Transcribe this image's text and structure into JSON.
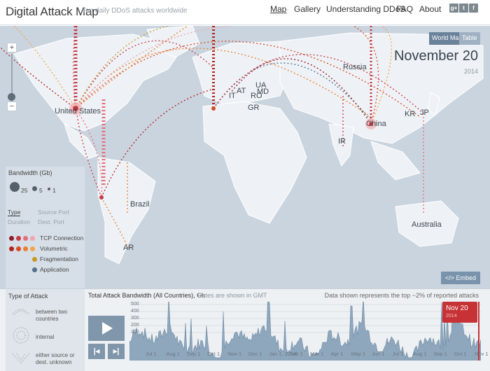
{
  "header": {
    "brand": "Digital Attack Map",
    "tagline": "Top daily DDoS attacks worldwide",
    "nav": [
      "Map",
      "Gallery",
      "Understanding DDoS",
      "FAQ",
      "About"
    ],
    "social": [
      "g+",
      "t",
      "f"
    ]
  },
  "map": {
    "view_world": "World Map",
    "view_table": "Table",
    "date": "November 20",
    "year": "2014",
    "zoom_in": "+",
    "zoom_out": "−",
    "embed": "</> Embed",
    "labels": {
      "us": "United States",
      "russia": "Russia",
      "brazil": "Brazil",
      "ar": "AR",
      "australia": "Australia",
      "china": "China",
      "kr": "KR",
      "jp": "JP",
      "gr": "GR",
      "ro": "RO",
      "md": "MD",
      "ua": "UA",
      "at": "AT",
      "it": "IT",
      "ir": "IR"
    }
  },
  "legend": {
    "title": "Bandwidth (Gb)",
    "sizes": [
      "25",
      "5",
      "1"
    ],
    "tabs": {
      "type": "Type",
      "source_port": "Source Port",
      "duration": "Duration",
      "dest_port": "Dest. Port"
    },
    "types": [
      {
        "label": "TCP Connection",
        "colors": [
          "#8e1d2c",
          "#c43b45",
          "#e36f79",
          "#f2a3b0"
        ]
      },
      {
        "label": "Volumetric",
        "colors": [
          "#b4231c",
          "#d94a26",
          "#ec7d2e",
          "#f4a449"
        ]
      },
      {
        "label": "Fragmentation",
        "colors": [
          "#c69826"
        ]
      },
      {
        "label": "Application",
        "colors": [
          "#55708c"
        ]
      }
    ]
  },
  "type_of_attack": {
    "title": "Type of Attack",
    "items": [
      "between two countries",
      "internal",
      "either source or dest. unknown"
    ]
  },
  "timeline": {
    "title": "Total Attack Bandwidth (All Countries), Gb",
    "note": "Dates are shown in GMT",
    "right_note": "Data shown represents the top ~2% of reported attacks",
    "flag_date": "Nov 20",
    "flag_year": "2014",
    "y_ticks": [
      "500",
      "400",
      "300",
      "200",
      "100"
    ],
    "x_ticks": [
      "Jul 1",
      "Aug 1",
      "Sep 1",
      "Oct 1",
      "Nov 1",
      "Dec 1",
      "Jan 1, 2014",
      "Feb 1",
      "Mar 1",
      "Apr 1",
      "May 1",
      "Jun 1",
      "Jul 1",
      "Aug 1",
      "Sep 1",
      "Oct 1",
      "Nov 1"
    ]
  }
}
